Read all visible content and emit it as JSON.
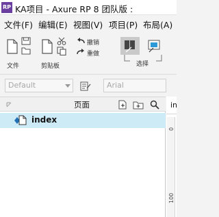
{
  "window": {
    "title": "KA项目 - Axure RP 8 团队版 : ",
    "app_icon": "RP"
  },
  "menu": {
    "items": [
      "文件(F)",
      "编辑(E)",
      "视图(V)",
      "项目(P)",
      "布局(A)"
    ]
  },
  "toolbar": {
    "file_label": "文件",
    "clipboard_label": "剪贴板",
    "undo_label": "撤销",
    "redo_label": "重做",
    "select_label": "选择"
  },
  "format": {
    "style_value": "Default",
    "font_value": "Arial"
  },
  "pages_panel": {
    "title": "页面",
    "pages": [
      {
        "label": "index",
        "selected": true
      }
    ]
  },
  "canvas": {
    "tab_label": "in",
    "ruler_marks": [
      "0",
      "100"
    ]
  },
  "colors": {
    "selection": "#cdeaf7",
    "app_icon": "#6b3fa0",
    "page_icon": "#1f6fb5"
  }
}
